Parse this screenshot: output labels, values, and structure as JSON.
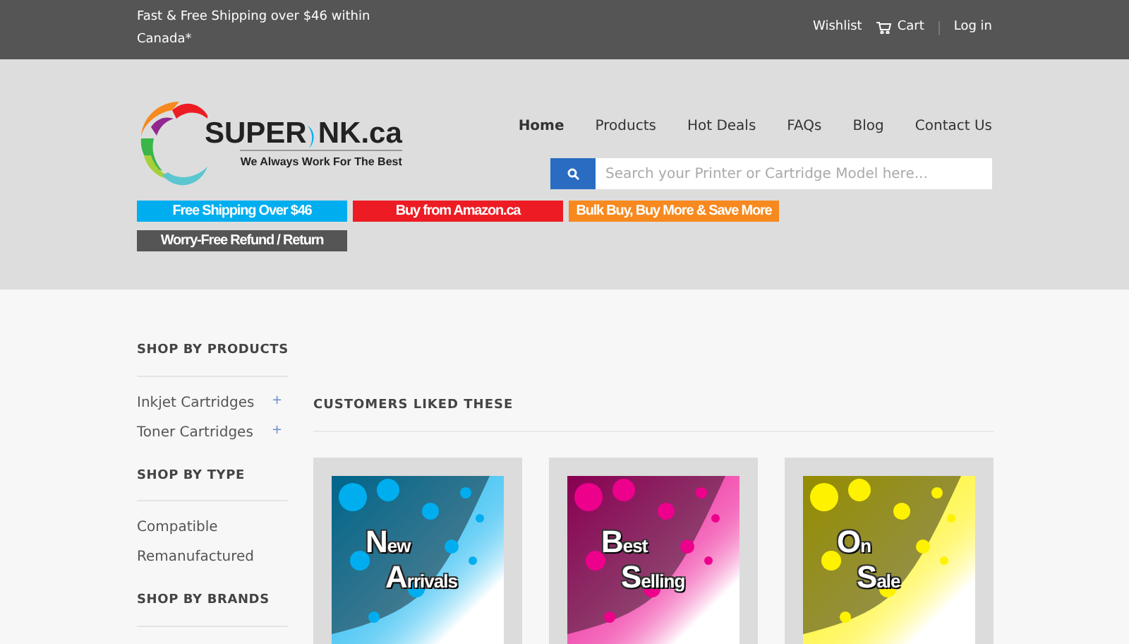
{
  "announcement": "Fast & Free Shipping over $46 within Canada*",
  "account_links": [
    {
      "label": "Wishlist",
      "kind": "text"
    },
    {
      "label": "Cart",
      "kind": "cart"
    },
    {
      "label": "Log in",
      "kind": "text"
    }
  ],
  "logo": {
    "word_before": "SUPER",
    "word_after": "NK.ca",
    "tagline": "We Always Work For The Best"
  },
  "nav": [
    {
      "label": "Home",
      "selected": true
    },
    {
      "label": "Products",
      "selected": false
    },
    {
      "label": "Hot Deals",
      "selected": false
    },
    {
      "label": "FAQs",
      "selected": false
    },
    {
      "label": "Blog",
      "selected": false
    },
    {
      "label": "Contact Us",
      "selected": false
    }
  ],
  "search": {
    "placeholder": "Search your Printer or Cartridge Model here..."
  },
  "promo_badges": [
    {
      "label": "Free Shipping Over $46",
      "color": "#00aeef"
    },
    {
      "label": "Buy from Amazon.ca",
      "color": "#ed1c24"
    },
    {
      "label": "Bulk Buy, Buy More & Save More",
      "color": "#f7891f"
    },
    {
      "label": "Worry-Free Refund / Return",
      "color": "#555555"
    }
  ],
  "sidebar": [
    {
      "title": "SHOP BY PRODUCTS",
      "items": [
        {
          "label": "Inkjet Cartridges",
          "expander": "+"
        },
        {
          "label": "Toner Cartridges",
          "expander": "+"
        }
      ]
    },
    {
      "title": "SHOP BY TYPE",
      "items": [
        {
          "label": "Compatible"
        },
        {
          "label": "Remanufactured"
        }
      ]
    },
    {
      "title": "SHOP BY BRANDS"
    }
  ],
  "section_title": "CUSTOMERS LIKED THESE",
  "cards": [
    {
      "lines": [
        "New",
        "Arrivals"
      ],
      "color": "#00aeef"
    },
    {
      "lines": [
        "Best",
        "Selling"
      ],
      "color": "#ec008c"
    },
    {
      "lines": [
        "On",
        "Sale"
      ],
      "color": "#fff200"
    }
  ]
}
